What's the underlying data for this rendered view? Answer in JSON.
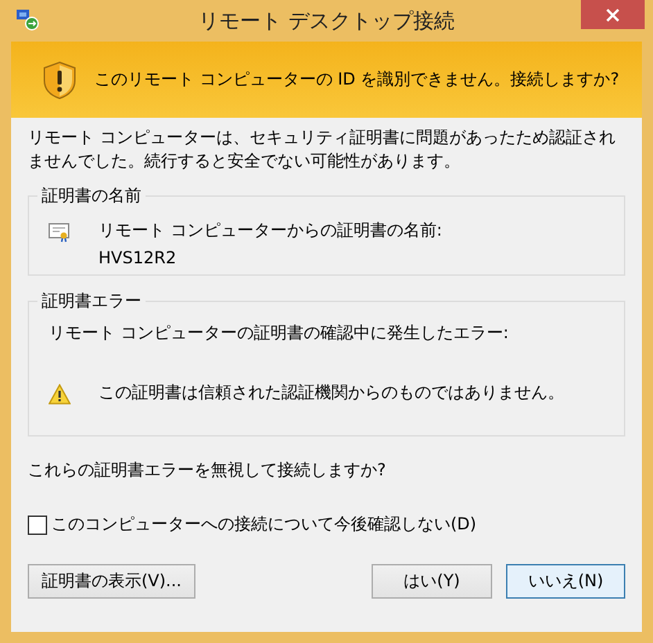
{
  "window": {
    "title": "リモート デスクトップ接続"
  },
  "banner": {
    "text": "このリモート コンピューターの ID を識別できません。接続しますか?"
  },
  "intro": "リモート コンピューターは、セキュリティ証明書に問題があったため認証されませんでした。続行すると安全でない可能性があります。",
  "groups": [
    {
      "title": "証明書の名前",
      "kind": "certificate",
      "lines": [
        "リモート コンピューターからの証明書の名前:",
        "HVS12R2"
      ]
    },
    {
      "title": "証明書エラー",
      "kind": "errors",
      "heading": "リモート コンピューターの証明書の確認中に発生したエラー:",
      "lines": [
        "この証明書は信頼された認証機関からのものではありません。"
      ]
    }
  ],
  "question": "これらの証明書エラーを無視して接続しますか?",
  "checkbox": {
    "label": "このコンピューターへの接続について今後確認しない(D)",
    "checked": false
  },
  "buttons": [
    {
      "label": "証明書の表示(V)...",
      "default": false
    },
    {
      "label": "はい(Y)",
      "default": false
    },
    {
      "label": "いいえ(N)",
      "default": true
    }
  ]
}
